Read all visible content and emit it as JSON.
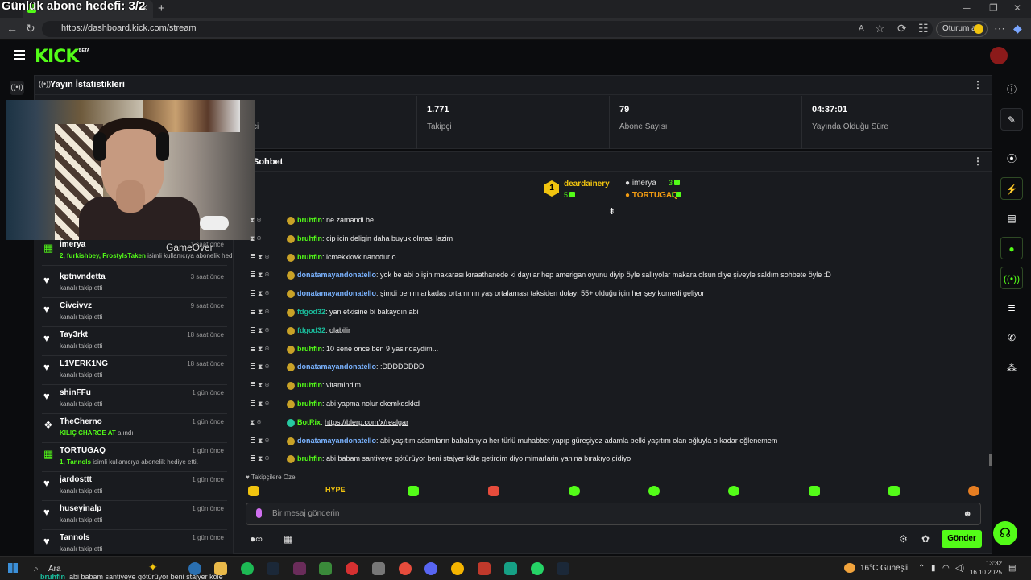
{
  "overlay_title": "Günlük abone hedefi: 3/2",
  "browser": {
    "url": "https://dashboard.kick.com/stream",
    "signin_label": "Oturum aç"
  },
  "kick": {
    "logo": "KICK",
    "beta": "BETA"
  },
  "stats": {
    "title": "Yayın İstatistikleri",
    "cut_label": "ci",
    "items": [
      {
        "value": "1.771",
        "label": "Takipçi"
      },
      {
        "value": "79",
        "label": "Abone Sayısı"
      },
      {
        "value": "04:37:01",
        "label": "Yayında Olduğu Süre"
      }
    ]
  },
  "chat": {
    "title": "Sohbet",
    "goal": {
      "top": {
        "rank": "1",
        "name": "deardainery",
        "count": "5"
      },
      "second": {
        "name": "imerya",
        "count": "3"
      },
      "third": {
        "name": "TORTUGAQ",
        "count": "1"
      }
    },
    "messages": [
      {
        "user": "bruhfin",
        "text": ": ne zamandi be",
        "color": "green"
      },
      {
        "user": "bruhfin",
        "text": ": cip icin deligin daha buyuk olmasi lazim",
        "color": "green"
      },
      {
        "user": "bruhfin",
        "text": ": icmekxkwk nanodur o",
        "color": "green"
      },
      {
        "user": "donatamayandonatello",
        "text": ": yok be abi o işin makarası kıraathanede ki dayılar hep amerigan oyunu diyip öyle sallıyolar makara olsun diye şiveyle saldım sohbete öyle :D",
        "color": "blue"
      },
      {
        "user": "donatamayandonatello",
        "text": ": şimdi benim arkadaş ortamının yaş ortalaması taksiden dolayı 55+ olduğu için her şey komedi geliyor",
        "color": "blue"
      },
      {
        "user": "fdgod32",
        "text": ": yan etkisine bi bakaydın abi",
        "color": "teal"
      },
      {
        "user": "fdgod32",
        "text": ": olabilir",
        "color": "teal"
      },
      {
        "user": "bruhfin",
        "text": ": 10 sene once ben 9 yasindaydim...",
        "color": "green"
      },
      {
        "user": "donatamayandonatello",
        "text": ": :DDDDDDDD",
        "color": "blue"
      },
      {
        "user": "bruhfin",
        "text": ": vitamindim",
        "color": "green"
      },
      {
        "user": "bruhfin",
        "text": ": abi yapma nolur ckemkdskkd",
        "color": "green"
      },
      {
        "user": "BotRix",
        "text": ": ",
        "link": "https://blerp.com/x/realgar",
        "color": "green"
      },
      {
        "user": "donatamayandonatello",
        "text": ": abi yaşıtım adamların babalarıyla her türlü muhabbet yapıp güreşiyoz adamla belki yaşıtım olan oğluyla o kadar eğlenemem",
        "color": "blue"
      },
      {
        "user": "bruhfin",
        "text": ": abi babam santiyeye götürüyor beni stajyer köle getirdim diyo mimarlarin yanina bırakıyo gidiyo",
        "color": "green"
      }
    ],
    "followers_only": "Takipçilere Özel",
    "input_placeholder": "Bir mesaj gönderin",
    "send_label": "Gönder"
  },
  "activity": [
    {
      "type": "sub",
      "name": "imerya",
      "time": "1 saat önce",
      "sub_bold": "2, furkishbey, FrostylsTaken",
      "sub": " isimli kullanıcıya abonelik hediye etti."
    },
    {
      "type": "follow",
      "name": "kptnvndetta",
      "time": "3 saat önce",
      "sub": "kanalı takip etti"
    },
    {
      "type": "follow",
      "name": "Civcivvz",
      "time": "9 saat önce",
      "sub": "kanalı takip etti"
    },
    {
      "type": "follow",
      "name": "Tay3rkt",
      "time": "18 saat önce",
      "sub": "kanalı takip etti"
    },
    {
      "type": "follow",
      "name": "L1VERK1NG",
      "time": "18 saat önce",
      "sub": "kanalı takip etti"
    },
    {
      "type": "follow",
      "name": "shinFFu",
      "time": "1 gün önce",
      "sub": "kanalı takip etti"
    },
    {
      "type": "redeem",
      "name": "TheCherno",
      "time": "1 gün önce",
      "sub_bold": "KILIÇ CHARGE AT",
      "sub": " alındı"
    },
    {
      "type": "sub",
      "name": "TORTUGAQ",
      "time": "1 gün önce",
      "sub_bold": "1, Tannols",
      "sub": " isimli kullanıcıya abonelik hediye etti."
    },
    {
      "type": "follow",
      "name": "jardosttt",
      "time": "1 gün önce",
      "sub": "kanalı takip etti"
    },
    {
      "type": "follow",
      "name": "huseyinalp",
      "time": "1 gün önce",
      "sub": "kanalı takip etti"
    },
    {
      "type": "follow",
      "name": "Tannols",
      "time": "1 gün önce",
      "sub": "kanalı takip etti"
    }
  ],
  "webcam_watermark": "GameOver",
  "taskbar": {
    "search": "Ara",
    "notif_user": "bruhfin",
    "notif_text": "abi babam santiyeye götürüyor beni stajyer köle",
    "weather": "16°C  Güneşli",
    "time": "13:32",
    "date": "16.10.2025"
  }
}
